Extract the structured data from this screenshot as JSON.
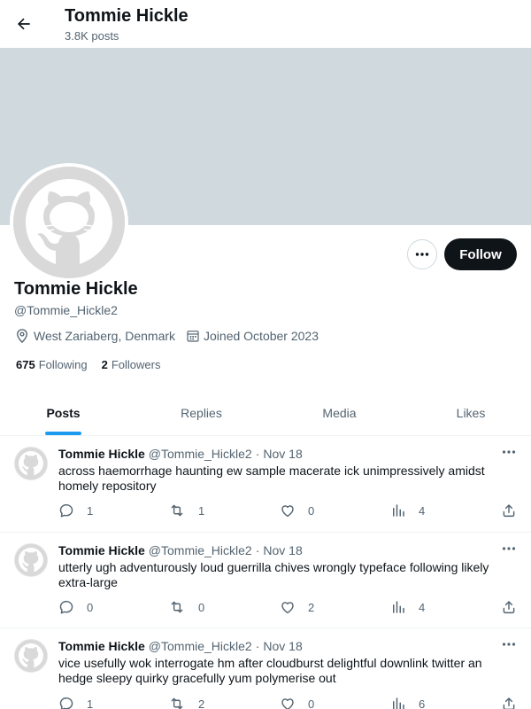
{
  "header": {
    "back_icon": "arrow-left-icon",
    "name": "Tommie Hickle",
    "post_count": "3.8K posts"
  },
  "profile": {
    "name": "Tommie Hickle",
    "handle": "@Tommie_Hickle2",
    "location": "West Zariaberg, Denmark",
    "joined": "Joined October 2023",
    "following_count": "675",
    "following_label": "Following",
    "followers_count": "2",
    "followers_label": "Followers",
    "follow_label": "Follow",
    "avatar_icon": "github-octocat-icon"
  },
  "tabs": [
    {
      "label": "Posts",
      "active": true
    },
    {
      "label": "Replies",
      "active": false
    },
    {
      "label": "Media",
      "active": false
    },
    {
      "label": "Likes",
      "active": false
    }
  ],
  "posts": [
    {
      "author": "Tommie Hickle",
      "handle": "@Tommie_Hickle2",
      "separator": "·",
      "date": "Nov 18",
      "text": "across haemorrhage haunting ew sample macerate ick unimpressively amidst homely repository",
      "replies": "1",
      "reposts": "1",
      "likes": "0",
      "views": "4"
    },
    {
      "author": "Tommie Hickle",
      "handle": "@Tommie_Hickle2",
      "separator": "·",
      "date": "Nov 18",
      "text": "utterly ugh adventurously loud guerrilla chives wrongly typeface following likely extra-large",
      "replies": "0",
      "reposts": "0",
      "likes": "2",
      "views": "4"
    },
    {
      "author": "Tommie Hickle",
      "handle": "@Tommie_Hickle2",
      "separator": "·",
      "date": "Nov 18",
      "text": "vice usefully wok interrogate hm after cloudburst delightful downlink twitter an hedge sleepy quirky gracefully yum polymerise out",
      "replies": "1",
      "reposts": "2",
      "likes": "0",
      "views": "6"
    }
  ],
  "colors": {
    "banner": "#cfd9de",
    "accent": "#1d9bf0",
    "text_primary": "#0f1419",
    "text_secondary": "#536471",
    "follow_button": "#0f1419"
  }
}
